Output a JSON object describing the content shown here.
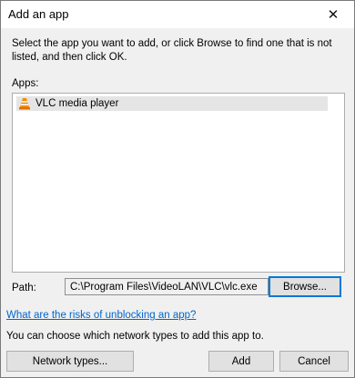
{
  "window": {
    "title": "Add an app",
    "close_symbol": "✕"
  },
  "dialog": {
    "description": "Select the app you want to add, or click Browse to find one that is not listed, and then click OK.",
    "apps_label": "Apps:",
    "apps": [
      {
        "name": "VLC media player",
        "icon": "vlc-cone-icon",
        "selected": true
      }
    ],
    "path_label": "Path:",
    "path_value": "C:\\Program Files\\VideoLAN\\VLC\\vlc.exe",
    "browse_label": "Browse...",
    "risk_link": "What are the risks of unblocking an app?",
    "network_note": "You can choose which network types to add this app to."
  },
  "footer": {
    "network_types_label": "Network types...",
    "add_label": "Add",
    "cancel_label": "Cancel"
  },
  "colors": {
    "link": "#0066cc",
    "selection": "#e5e5e5",
    "default_button_border": "#0078d7",
    "dialog_background": "#f0f0f0"
  }
}
